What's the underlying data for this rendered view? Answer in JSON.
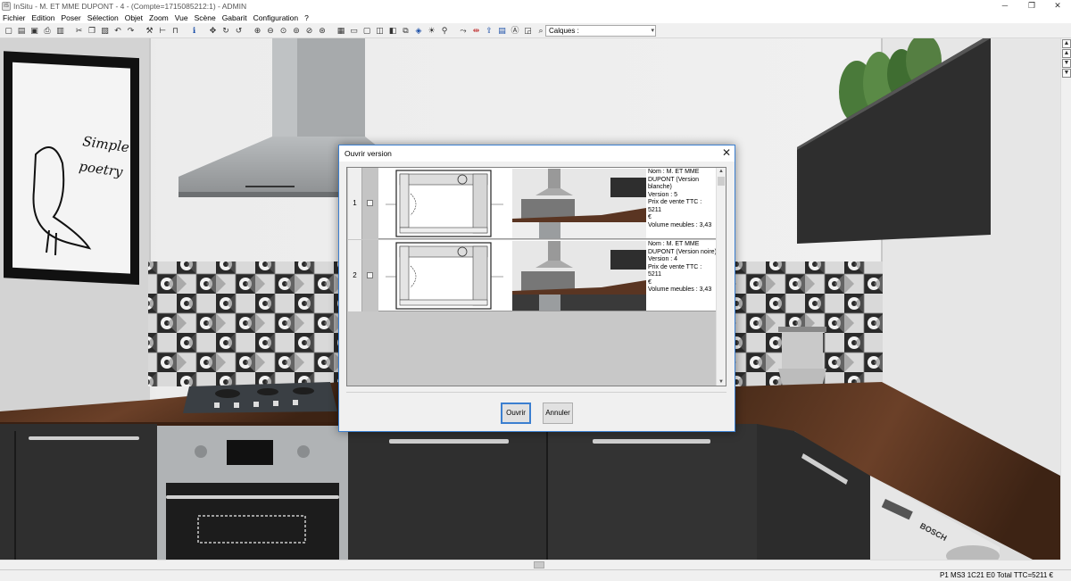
{
  "window": {
    "title": "InSitu - M. ET MME DUPONT - 4 - (Compte=1715085212:1) - ADMIN",
    "app_icon": "IS",
    "controls": {
      "minimize": "─",
      "maximize": "❐",
      "close": "✕"
    }
  },
  "menu": [
    "Fichier",
    "Edition",
    "Poser",
    "Sélection",
    "Objet",
    "Zoom",
    "Vue",
    "Scène",
    "Gabarit",
    "Configuration",
    "?"
  ],
  "toolbar": {
    "buttons": [
      {
        "icon": "new-icon",
        "glyph": "▢"
      },
      {
        "icon": "open-icon",
        "glyph": "▤"
      },
      {
        "icon": "save-icon",
        "glyph": "▣"
      },
      {
        "icon": "print-icon",
        "glyph": "⎙"
      },
      {
        "icon": "preview-icon",
        "glyph": "▥"
      },
      {
        "sep": true
      },
      {
        "icon": "cut-icon",
        "glyph": "✂"
      },
      {
        "icon": "copy-icon",
        "glyph": "❐"
      },
      {
        "icon": "paste-icon",
        "glyph": "▧"
      },
      {
        "icon": "undo-icon",
        "glyph": "↶"
      },
      {
        "icon": "redo-icon",
        "glyph": "↷"
      },
      {
        "sep": true
      },
      {
        "icon": "tool-icon",
        "glyph": "⚒"
      },
      {
        "icon": "measure-icon",
        "glyph": "⊢"
      },
      {
        "icon": "wall-icon",
        "glyph": "⊓"
      },
      {
        "sep": true
      },
      {
        "icon": "info-icon",
        "glyph": "ℹ",
        "color": "blue"
      },
      {
        "sep": true
      },
      {
        "icon": "move-icon",
        "glyph": "✥"
      },
      {
        "icon": "rotate-icon",
        "glyph": "↻"
      },
      {
        "icon": "rotate-alt-icon",
        "glyph": "↺"
      },
      {
        "sep": true
      },
      {
        "icon": "zoom-in-icon",
        "glyph": "⊕"
      },
      {
        "icon": "zoom-out-icon",
        "glyph": "⊖"
      },
      {
        "icon": "zoom-window-icon",
        "glyph": "⊙"
      },
      {
        "icon": "zoom-fit-icon",
        "glyph": "⊚"
      },
      {
        "icon": "zoom-previous-icon",
        "glyph": "⊘"
      },
      {
        "icon": "zoom-all-icon",
        "glyph": "⊛"
      },
      {
        "sep": true
      },
      {
        "icon": "plan-view-icon",
        "glyph": "▦"
      },
      {
        "icon": "view-2d-icon",
        "glyph": "▭"
      },
      {
        "icon": "view-front-icon",
        "glyph": "▢"
      },
      {
        "icon": "view-3d-icon",
        "glyph": "◫"
      },
      {
        "icon": "view-perspective-icon",
        "glyph": "◧"
      },
      {
        "icon": "camera-icon",
        "glyph": "⧉"
      },
      {
        "icon": "render-icon",
        "glyph": "◈",
        "color": "blue"
      },
      {
        "icon": "light-icon",
        "glyph": "☀"
      },
      {
        "icon": "walk-icon",
        "glyph": "⚲"
      },
      {
        "sep": true
      },
      {
        "icon": "spline-icon",
        "glyph": "⤳"
      },
      {
        "icon": "dimension-icon",
        "glyph": "⇹",
        "color": "red"
      },
      {
        "icon": "export-icon",
        "glyph": "⇪",
        "color": "blue"
      },
      {
        "icon": "word-icon",
        "glyph": "▤",
        "color": "blue"
      },
      {
        "icon": "text-icon",
        "glyph": "Ⓐ"
      },
      {
        "icon": "photo-icon",
        "glyph": "◲"
      },
      {
        "icon": "search-help-icon",
        "glyph": "⌕"
      },
      {
        "icon": "help-icon",
        "glyph": "?"
      }
    ],
    "layers": {
      "label": "Calques :",
      "arrow": "▾"
    }
  },
  "dialog": {
    "title": "Ouvrir version",
    "close_glyph": "✕",
    "versions": [
      {
        "number": "1",
        "info": [
          "Nom : M. ET MME",
          "DUPONT  (Version",
          "blanche)",
          "Version : 5",
          "Prix de vente TTC : 5211",
          "€",
          "Volume meubles : 3,43"
        ],
        "cabinet_color": "#eeeeee"
      },
      {
        "number": "2",
        "info": [
          "Nom : M. ET MME",
          "DUPONT  (Version noire)",
          "Version : 4",
          "Prix de vente TTC : 5211",
          "€",
          "Volume meubles : 3,43"
        ],
        "cabinet_color": "#3a3a3a"
      }
    ],
    "scroll_up": "▲",
    "scroll_down": "▼",
    "open_button": "Ouvrir",
    "cancel_button": "Annuler"
  },
  "scene": {
    "poster_text_1": "Simple",
    "poster_text_2": "poetry",
    "oven_brand": "BOSCH"
  },
  "scrollbar": {
    "up": "▲",
    "down": "▼",
    "left": "◀",
    "right": "▶"
  },
  "status": "P1 MS3 1C21 E0 Total TTC=5211 €"
}
